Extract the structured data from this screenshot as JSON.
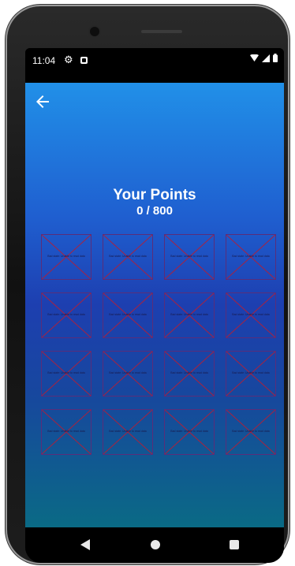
{
  "status_bar": {
    "time": "11:04",
    "icons": [
      "settings-gear-icon",
      "notification-icon",
      "wifi-icon",
      "signal-icon",
      "battery-icon"
    ]
  },
  "header": {
    "back_icon": "arrow-back-icon"
  },
  "points": {
    "title": "Your Points",
    "score": "0 / 800"
  },
  "cards": [
    {
      "text": "Bad state: Unable to read data"
    },
    {
      "text": "Bad state: Unable to read data"
    },
    {
      "text": "Bad state: Unable to read data"
    },
    {
      "text": "Bad state: Unable to read data"
    },
    {
      "text": "Bad state: Unable to read data"
    },
    {
      "text": "Bad state: Unable to read data"
    },
    {
      "text": "Bad state: Unable to read data"
    },
    {
      "text": "Bad state: Unable to read data"
    },
    {
      "text": "Bad state: Unable to read data"
    },
    {
      "text": "Bad state: Unable to read data"
    },
    {
      "text": "Bad state: Unable to read data"
    },
    {
      "text": "Bad state: Unable to read data"
    },
    {
      "text": "Bad state: Unable to read data"
    },
    {
      "text": "Bad state: Unable to read data"
    },
    {
      "text": "Bad state: Unable to read data"
    },
    {
      "text": "Bad state: Unable to read data"
    }
  ],
  "nav_bar": {
    "icons": [
      "nav-back-icon",
      "nav-home-icon",
      "nav-recents-icon"
    ]
  },
  "colors": {
    "gradient_top": "#2190e8",
    "gradient_mid": "#1d3fb0",
    "gradient_bottom": "#0a6a85",
    "placeholder_cross": "#b0203a"
  }
}
